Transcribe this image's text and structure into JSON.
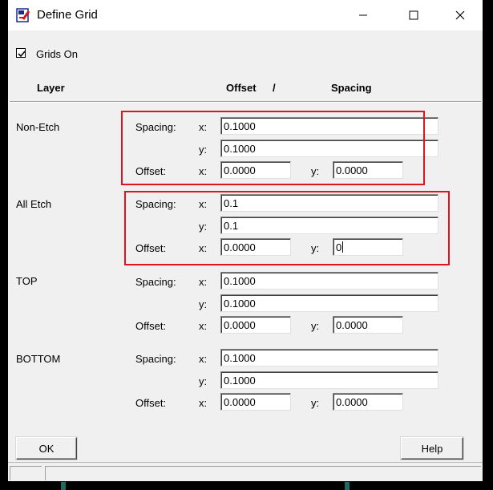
{
  "window": {
    "title": "Define Grid",
    "controls": [
      "minimize-icon",
      "maximize-icon",
      "close-icon"
    ]
  },
  "grids_on": {
    "label": "Grids On",
    "checked": true
  },
  "headers": {
    "layer": "Layer",
    "offset": "Offset",
    "slash": "/",
    "spacing": "Spacing"
  },
  "labels": {
    "spacing": "Spacing:",
    "offset": "Offset:",
    "x": "x:",
    "y": "y:"
  },
  "layers": [
    {
      "name": "Non-Etch",
      "spacing_x": "0.1000",
      "spacing_y": "0.1000",
      "offset_x": "0.0000",
      "offset_y": "0.0000"
    },
    {
      "name": "All Etch",
      "spacing_x": "0.1",
      "spacing_y": "0.1",
      "offset_x": "0.0000",
      "offset_y": "0"
    },
    {
      "name": "TOP",
      "spacing_x": "0.1000",
      "spacing_y": "0.1000",
      "offset_x": "0.0000",
      "offset_y": "0.0000"
    },
    {
      "name": "BOTTOM",
      "spacing_x": "0.1000",
      "spacing_y": "0.1000",
      "offset_x": "0.0000",
      "offset_y": "0.0000"
    }
  ],
  "buttons": {
    "ok": "OK",
    "help": "Help"
  },
  "colors": {
    "highlight": "#e0141e",
    "background": "#f0f0f0"
  }
}
